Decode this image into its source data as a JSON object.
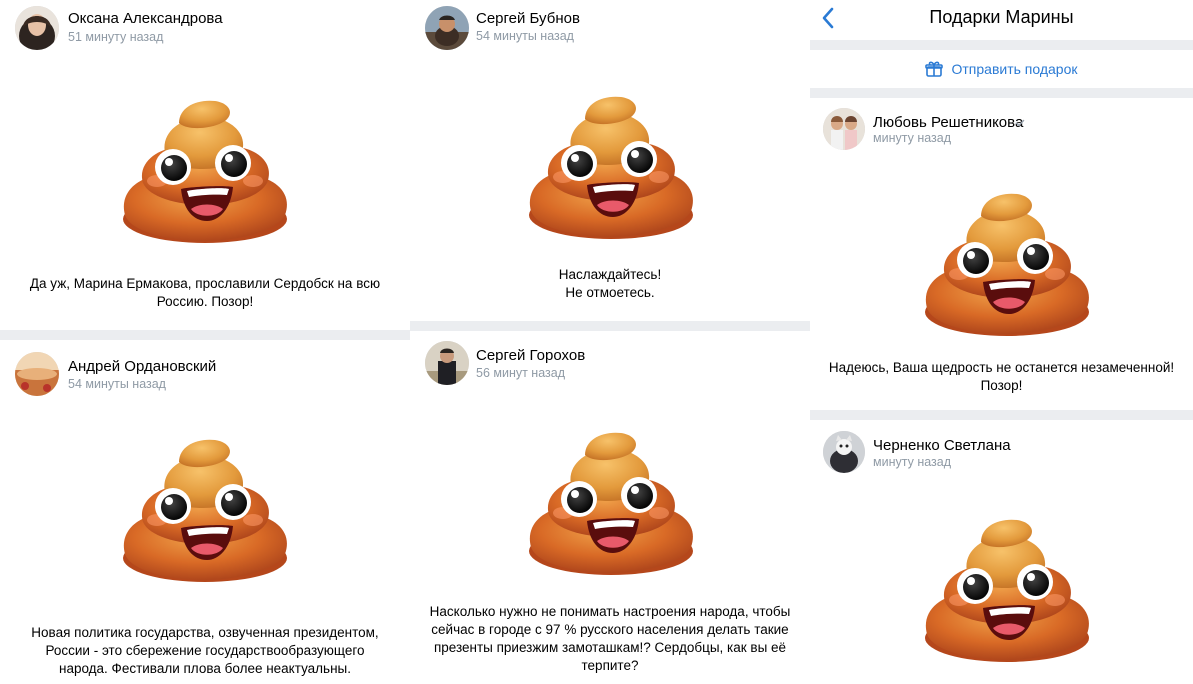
{
  "posts": [
    {
      "name": "Оксана Александрова",
      "time": "51 минуту назад",
      "caption": [
        "Да уж, Марина Ермакова, прославили Сердобск на всю",
        "Россию. Позор!"
      ]
    },
    {
      "name": "Андрей Ордановский",
      "time": "54 минуты назад",
      "caption": [
        "Новая политика государства, озвученная президентом,",
        "России - это сбережение государствообразующего",
        "народа. Фестивали плова более неактуальны."
      ]
    },
    {
      "name": "Сергей Бубнов",
      "time": "54 минуты назад",
      "caption": [
        "Наслаждайтесь!",
        "Не отмоетесь."
      ]
    },
    {
      "name": "Сергей Горохов",
      "time": "56 минут назад",
      "caption": [
        "Насколько нужно не понимать настроения народа, чтобы",
        "сейчас в городе с 97 % русского населения делать такие",
        "презенты приезжим замоташкам!? Сердобцы, как вы её",
        "терпите?"
      ]
    }
  ],
  "gifts_page": {
    "title": "Подарки Марины",
    "send_gift_label": "Отправить подарок",
    "posts": [
      {
        "name": "Любовь Решетникова",
        "time": "минуту назад",
        "verified": true,
        "caption": [
          "Надеюсь, Ваша щедрость не останется незамеченной!",
          "Позор!"
        ]
      },
      {
        "name": "Черненко Светлана",
        "time": "минуту назад",
        "caption": []
      }
    ]
  },
  "colors": {
    "accent": "#2a7ad4",
    "secondary_text": "#8f9aa5",
    "separator": "#ebedf0"
  },
  "icons": [
    "back-chevron-icon",
    "gift-icon",
    "verified-check-icon",
    "poop-emoji-icon"
  ]
}
